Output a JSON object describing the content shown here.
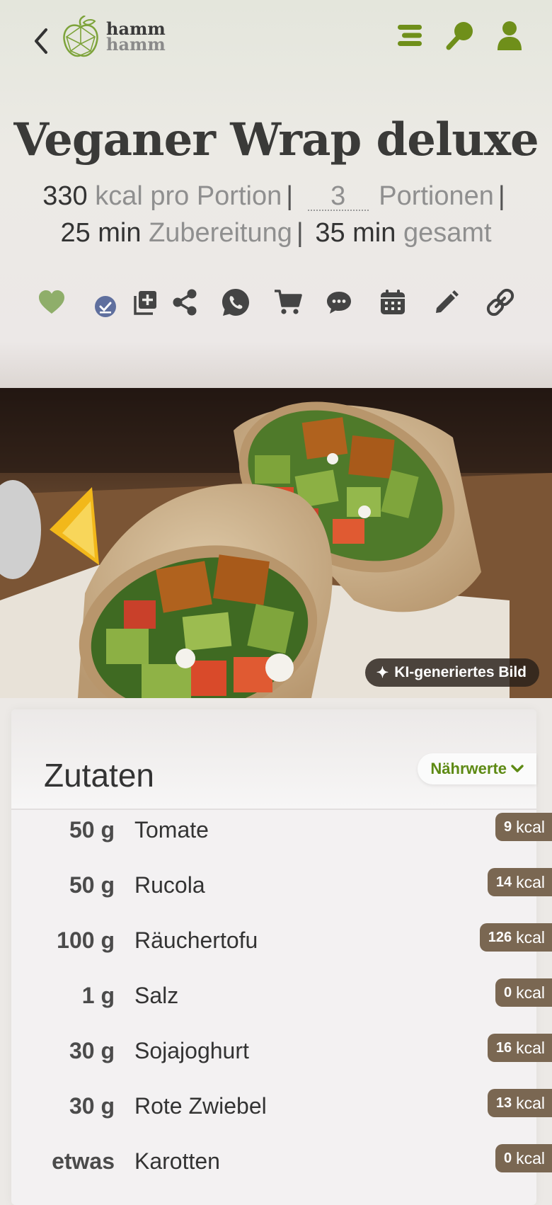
{
  "header": {
    "logo_line1": "hamm",
    "logo_line2": "hamm"
  },
  "icons": {
    "back": "chevron-left-icon",
    "menu": "menu-icon",
    "search": "search-icon",
    "user": "user-icon",
    "favorite": "heart-icon",
    "done": "check-circle-icon",
    "add_collection": "add-box-icon",
    "share": "share-icon",
    "whatsapp": "whatsapp-icon",
    "cart": "cart-icon",
    "comments": "comment-icon",
    "calendar": "calendar-icon",
    "edit": "pencil-icon",
    "link": "link-icon"
  },
  "colors": {
    "accent_green": "#6f8f1a",
    "heart_green": "#8fae6a",
    "check_blue": "#5f6f9e",
    "kcal_badge": "#7a6752"
  },
  "recipe": {
    "title": "Veganer Wrap deluxe",
    "kcal_value": "330",
    "kcal_label": "kcal pro Portion",
    "portions_value": "3",
    "portions_label": "Portionen",
    "prep_value": "25 min",
    "prep_label": "Zubereitung",
    "total_value": "35 min",
    "total_label": "gesamt"
  },
  "photo": {
    "ai_badge": "KI-generiertes Bild"
  },
  "ingredients": {
    "title": "Zutaten",
    "nutrition_button": "Nährwerte",
    "kcal_unit": "kcal",
    "items": [
      {
        "amount": "50 g",
        "name": "Tomate",
        "kcal": "9"
      },
      {
        "amount": "50 g",
        "name": "Rucola",
        "kcal": "14"
      },
      {
        "amount": "100 g",
        "name": "Räuchertofu",
        "kcal": "126"
      },
      {
        "amount": "1 g",
        "name": "Salz",
        "kcal": "0"
      },
      {
        "amount": "30 g",
        "name": "Sojajoghurt",
        "kcal": "16"
      },
      {
        "amount": "30 g",
        "name": "Rote Zwiebel",
        "kcal": "13"
      },
      {
        "amount": "etwas",
        "name": "Karotten",
        "kcal": "0"
      }
    ]
  }
}
